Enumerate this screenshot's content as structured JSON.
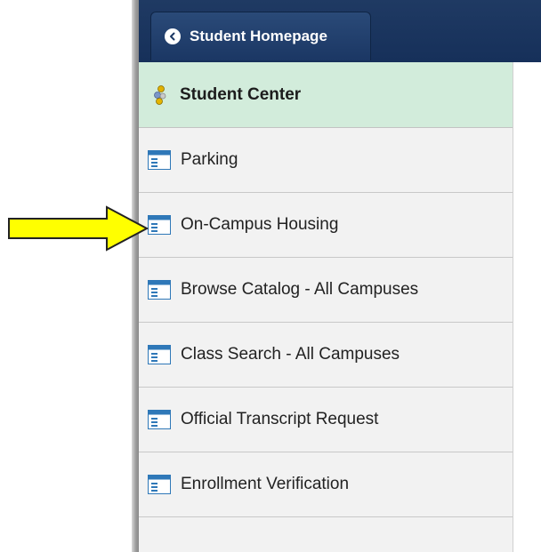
{
  "header": {
    "back_button_label": "Student Homepage"
  },
  "nav": {
    "title": "Student Center",
    "items": [
      {
        "label": "Parking"
      },
      {
        "label": "On-Campus Housing"
      },
      {
        "label": "Browse Catalog - All Campuses"
      },
      {
        "label": "Class Search - All Campuses"
      },
      {
        "label": "Official Transcript Request"
      },
      {
        "label": "Enrollment Verification"
      }
    ]
  },
  "annotation": {
    "arrow_color": "#ffff00",
    "points_to": "On-Campus Housing"
  },
  "icons": {
    "back": "chevron-left-icon",
    "header": "student-center-icon",
    "item": "page-icon"
  }
}
